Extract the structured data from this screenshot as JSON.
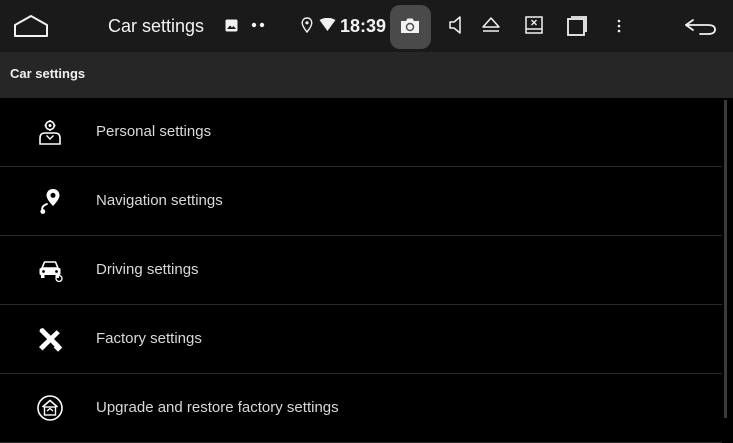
{
  "statusbar": {
    "home_icon": "home-outline-icon",
    "title": "Car settings",
    "notification_icon": "image-notification-icon",
    "more_dots_icon": "more-dots-icon",
    "location_icon": "location-pin-icon",
    "wifi_icon": "wifi-icon",
    "time": "18:39",
    "camera_icon": "screenshot-camera-icon",
    "volume_icon": "volume-icon",
    "eject_icon": "eject-icon",
    "close_app_icon": "close-app-icon",
    "recents_icon": "recents-icon",
    "menu_icon": "overflow-menu-icon",
    "back_icon": "back-arrow-icon"
  },
  "appbar": {
    "title": "Car settings"
  },
  "settings": {
    "items": [
      {
        "label": "Personal settings",
        "icon": "person-gear-icon"
      },
      {
        "label": "Navigation settings",
        "icon": "navigation-pin-icon"
      },
      {
        "label": "Driving settings",
        "icon": "car-icon"
      },
      {
        "label": "Factory settings",
        "icon": "tools-icon"
      },
      {
        "label": "Upgrade and restore factory settings",
        "icon": "upgrade-icon"
      }
    ]
  },
  "colors": {
    "background": "#000000",
    "statusbar": "#1a1a1a",
    "appbar": "#262626",
    "text": "#d9d9d9"
  }
}
